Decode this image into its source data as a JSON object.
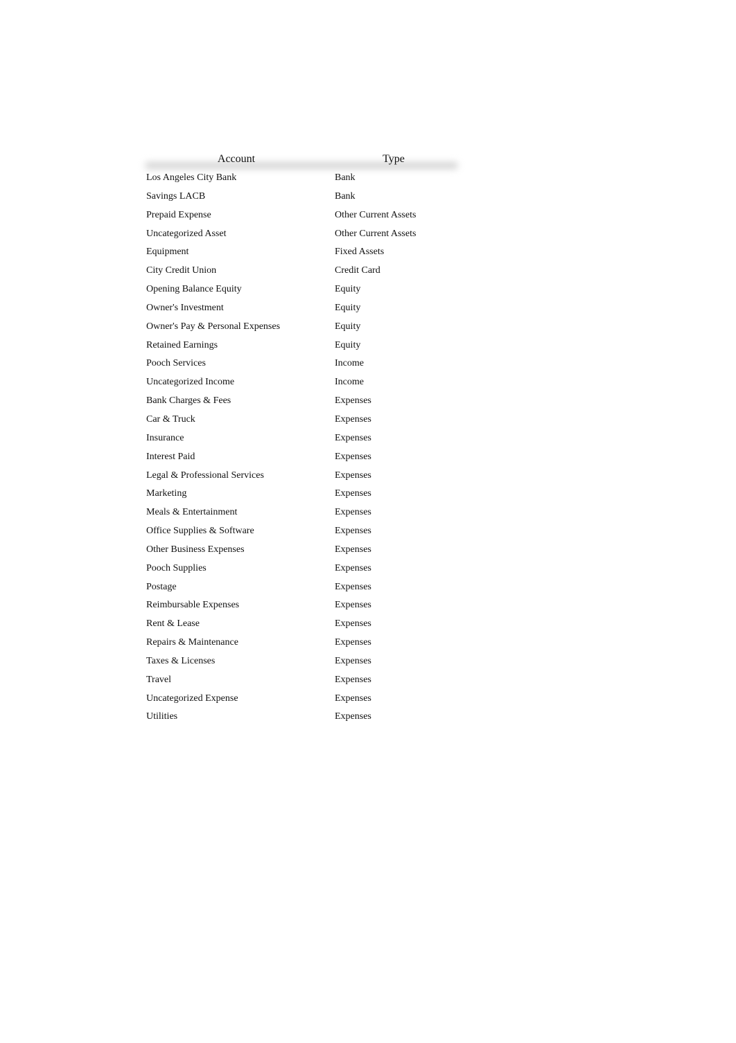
{
  "table": {
    "headers": {
      "account": "Account",
      "type": "Type"
    },
    "rows": [
      {
        "account": "Los Angeles City Bank",
        "type": "Bank"
      },
      {
        "account": "Savings LACB",
        "type": "Bank"
      },
      {
        "account": "Prepaid Expense",
        "type": "Other Current Assets"
      },
      {
        "account": "Uncategorized Asset",
        "type": "Other Current Assets"
      },
      {
        "account": "Equipment",
        "type": "Fixed Assets"
      },
      {
        "account": "City Credit Union",
        "type": "Credit Card"
      },
      {
        "account": "Opening Balance Equity",
        "type": "Equity"
      },
      {
        "account": "Owner's Investment",
        "type": "Equity"
      },
      {
        "account": "Owner's Pay & Personal Expenses",
        "type": "Equity"
      },
      {
        "account": "Retained Earnings",
        "type": "Equity"
      },
      {
        "account": "Pooch Services",
        "type": "Income"
      },
      {
        "account": "Uncategorized Income",
        "type": "Income"
      },
      {
        "account": "Bank Charges & Fees",
        "type": "Expenses"
      },
      {
        "account": "Car & Truck",
        "type": "Expenses"
      },
      {
        "account": "Insurance",
        "type": "Expenses"
      },
      {
        "account": "Interest Paid",
        "type": "Expenses"
      },
      {
        "account": "Legal & Professional Services",
        "type": "Expenses"
      },
      {
        "account": "Marketing",
        "type": "Expenses"
      },
      {
        "account": "Meals & Entertainment",
        "type": "Expenses"
      },
      {
        "account": "Office Supplies & Software",
        "type": "Expenses"
      },
      {
        "account": "Other Business Expenses",
        "type": "Expenses"
      },
      {
        "account": "Pooch Supplies",
        "type": "Expenses"
      },
      {
        "account": "Postage",
        "type": "Expenses"
      },
      {
        "account": "Reimbursable Expenses",
        "type": "Expenses"
      },
      {
        "account": "Rent & Lease",
        "type": "Expenses"
      },
      {
        "account": "Repairs & Maintenance",
        "type": "Expenses"
      },
      {
        "account": "Taxes & Licenses",
        "type": "Expenses"
      },
      {
        "account": "Travel",
        "type": "Expenses"
      },
      {
        "account": "Uncategorized Expense",
        "type": "Expenses"
      },
      {
        "account": "Utilities",
        "type": "Expenses"
      }
    ]
  }
}
